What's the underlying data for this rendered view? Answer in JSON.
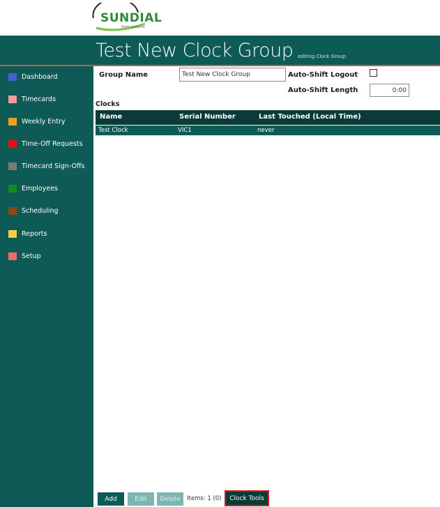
{
  "logo": {
    "text": "SUNDIAL",
    "subtext": "time systems"
  },
  "header": {
    "title": "Test New Clock Group",
    "subtitle": "editing Clock Group"
  },
  "sidebar": {
    "items": [
      {
        "label": "Dashboard",
        "color": "#4a5fd6"
      },
      {
        "label": "Timecards",
        "color": "#f39a9a"
      },
      {
        "label": "Weekly Entry",
        "color": "#f0a020"
      },
      {
        "label": "Time-Off Requests",
        "color": "#e81010"
      },
      {
        "label": "Timecard Sign-Offs",
        "color": "#7a7a7a"
      },
      {
        "label": "Employees",
        "color": "#128a1c"
      },
      {
        "label": "Scheduling",
        "color": "#8a4a10"
      },
      {
        "label": "Reports",
        "color": "#f5d040"
      },
      {
        "label": "Setup",
        "color": "#f06a6a"
      }
    ]
  },
  "form": {
    "group_name_label": "Group Name",
    "group_name_value": "Test New Clock Group",
    "auto_shift_logout_label": "Auto-Shift Logout",
    "auto_shift_logout_checked": false,
    "auto_shift_length_label": "Auto-Shift Length",
    "auto_shift_length_value": "0:00"
  },
  "clocks": {
    "section_label": "Clocks",
    "columns": [
      "Name",
      "Serial Number",
      "Last Touched (Local Time)"
    ],
    "rows": [
      [
        "Test Clock",
        "VIC1",
        "never"
      ]
    ]
  },
  "footer": {
    "add_label": "Add",
    "edit_label": "Edit",
    "delete_label": "Delete",
    "items_text": "Items: 1 (0)",
    "clock_tools_label": "Clock Tools"
  },
  "colors": {
    "primary": "#0e5a56",
    "header_dark": "#0b3b38",
    "accent_red": "#d9534f"
  }
}
